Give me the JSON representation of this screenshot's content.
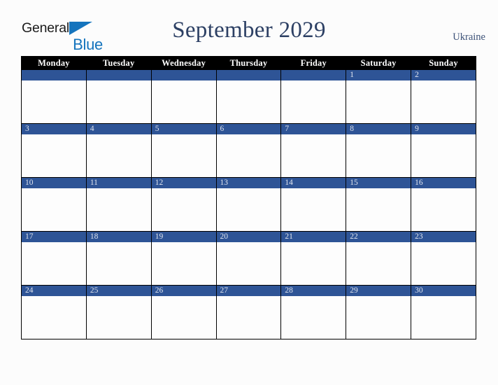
{
  "logo": {
    "word_top": "General",
    "word_bottom": "Blue",
    "triangle_color": "#1574bd",
    "top_text_color": "#1b1b1b",
    "bottom_text_color": "#1574bd",
    "icon": "triangle-icon"
  },
  "header": {
    "month_title": "September 2029",
    "country": "Ukraine",
    "title_color": "#2d4064",
    "country_color": "#3d5278"
  },
  "calendar": {
    "weekday_headers": [
      "Monday",
      "Tuesday",
      "Wednesday",
      "Thursday",
      "Friday",
      "Saturday",
      "Sunday"
    ],
    "header_background": "#000000",
    "header_text_color": "#ffffff",
    "daybar_background": "#2e5496",
    "daybar_text_color": "#dfe4ee",
    "cell_background": "#fdfdfd",
    "border_color": "#000000",
    "weeks": [
      [
        {
          "day": "",
          "blank": true
        },
        {
          "day": "",
          "blank": true
        },
        {
          "day": "",
          "blank": true
        },
        {
          "day": "",
          "blank": true
        },
        {
          "day": "",
          "blank": true
        },
        {
          "day": "1",
          "blank": false
        },
        {
          "day": "2",
          "blank": false
        }
      ],
      [
        {
          "day": "3",
          "blank": false
        },
        {
          "day": "4",
          "blank": false
        },
        {
          "day": "5",
          "blank": false
        },
        {
          "day": "6",
          "blank": false
        },
        {
          "day": "7",
          "blank": false
        },
        {
          "day": "8",
          "blank": false
        },
        {
          "day": "9",
          "blank": false
        }
      ],
      [
        {
          "day": "10",
          "blank": false
        },
        {
          "day": "11",
          "blank": false
        },
        {
          "day": "12",
          "blank": false
        },
        {
          "day": "13",
          "blank": false
        },
        {
          "day": "14",
          "blank": false
        },
        {
          "day": "15",
          "blank": false
        },
        {
          "day": "16",
          "blank": false
        }
      ],
      [
        {
          "day": "17",
          "blank": false
        },
        {
          "day": "18",
          "blank": false
        },
        {
          "day": "19",
          "blank": false
        },
        {
          "day": "20",
          "blank": false
        },
        {
          "day": "21",
          "blank": false
        },
        {
          "day": "22",
          "blank": false
        },
        {
          "day": "23",
          "blank": false
        }
      ],
      [
        {
          "day": "24",
          "blank": false
        },
        {
          "day": "25",
          "blank": false
        },
        {
          "day": "26",
          "blank": false
        },
        {
          "day": "27",
          "blank": false
        },
        {
          "day": "28",
          "blank": false
        },
        {
          "day": "29",
          "blank": false
        },
        {
          "day": "30",
          "blank": false
        }
      ]
    ]
  },
  "page": {
    "background": "#fcfcfc"
  }
}
